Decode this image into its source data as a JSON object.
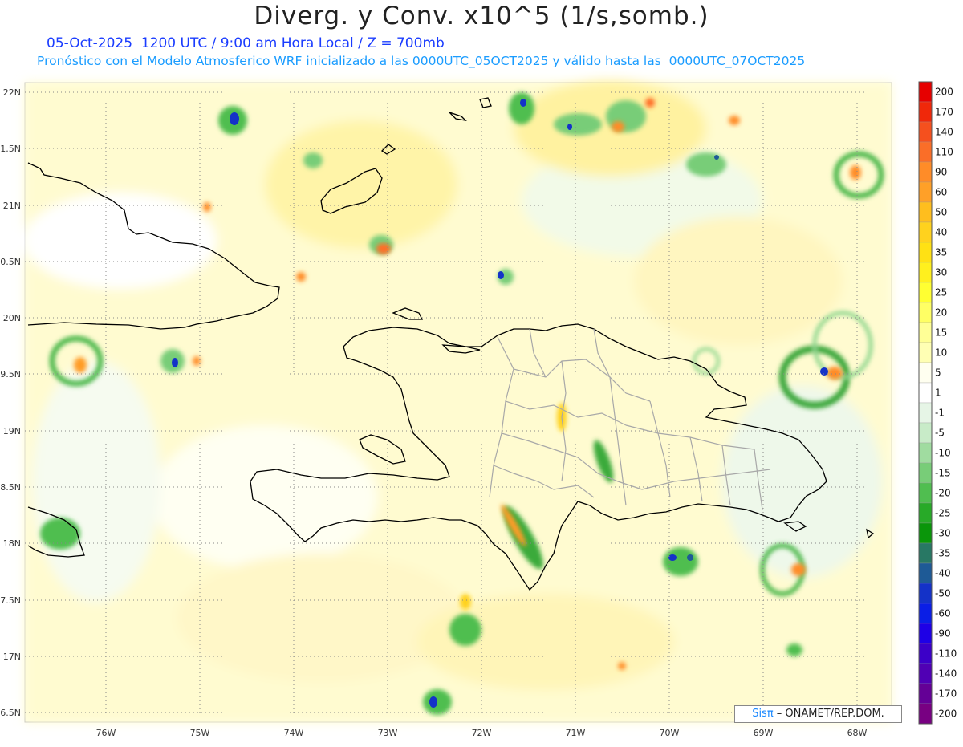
{
  "header": {
    "title": "Diverg. y Conv. x10^5 (1/s,somb.)",
    "subtitle1": "05-Oct-2025  1200 UTC / 9:00 am Hora Local / Z = 700mb",
    "subtitle2": "Pronóstico con el Modelo Atmosferico WRF inicializado a las 0000UTC_05OCT2025 y válido hasta las  0000UTC_07OCT2025"
  },
  "axes": {
    "lat_labels": [
      "22N",
      "1.5N",
      "21N",
      "0.5N",
      "20N",
      "9.5N",
      "19N",
      "8.5N",
      "18N",
      "7.5N",
      "17N",
      "6.5N"
    ],
    "lon_labels": [
      "76W",
      "75W",
      "74W",
      "73W",
      "72W",
      "71W",
      "70W",
      "69W",
      "68W"
    ]
  },
  "legend": {
    "levels": [
      "200",
      "170",
      "140",
      "110",
      "90",
      "60",
      "50",
      "40",
      "35",
      "30",
      "25",
      "20",
      "15",
      "10",
      "5",
      "1",
      "-1",
      "-5",
      "-10",
      "-15",
      "-20",
      "-25",
      "-30",
      "-35",
      "-40",
      "-50",
      "-60",
      "-90",
      "-110",
      "-140",
      "-170",
      "-200"
    ],
    "colors": [
      "#e60000",
      "#f0280a",
      "#f5501e",
      "#fa6e28",
      "#ff8c28",
      "#ffa028",
      "#ffbe1e",
      "#ffd21e",
      "#ffe114",
      "#fff01e",
      "#ffff32",
      "#ffff64",
      "#ffff96",
      "#ffffb4",
      "#fffff0",
      "#ffffff",
      "#e6f5e6",
      "#c8ebc8",
      "#a0dca0",
      "#78cd78",
      "#50be50",
      "#28aa28",
      "#0a960a",
      "#287864",
      "#1e5a96",
      "#1432c8",
      "#0a1ee6",
      "#1e00e6",
      "#3c00c8",
      "#5000b4",
      "#640096",
      "#780082"
    ]
  },
  "credit": {
    "brand": "Sis",
    "pi": "π",
    "text": " – ONAMET/REP.DOM."
  }
}
